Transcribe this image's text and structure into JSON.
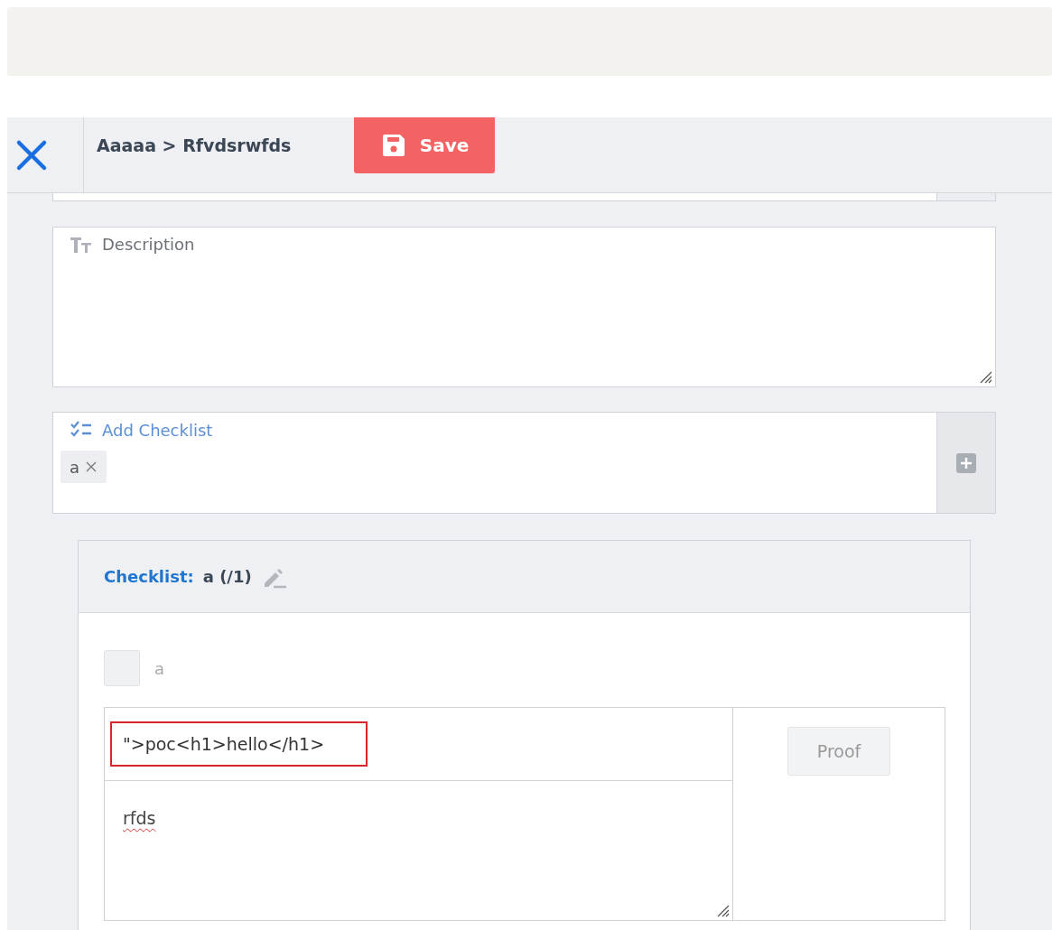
{
  "header": {
    "breadcrumb": "Aaaaa > Rfvdsrwfds",
    "save_label": "Save"
  },
  "description": {
    "placeholder": "Description"
  },
  "checklist_field": {
    "placeholder": "Add Checklist",
    "tags": [
      {
        "label": "a"
      }
    ]
  },
  "checklist": {
    "label": "Checklist:",
    "name": "a (/1)",
    "items": [
      {
        "label": "a",
        "checked": false,
        "title_value": "\">poc<h1>hello</h1>",
        "body_value": "rfds",
        "proof_label": "Proof",
        "proof_disabled": true
      }
    ]
  }
}
